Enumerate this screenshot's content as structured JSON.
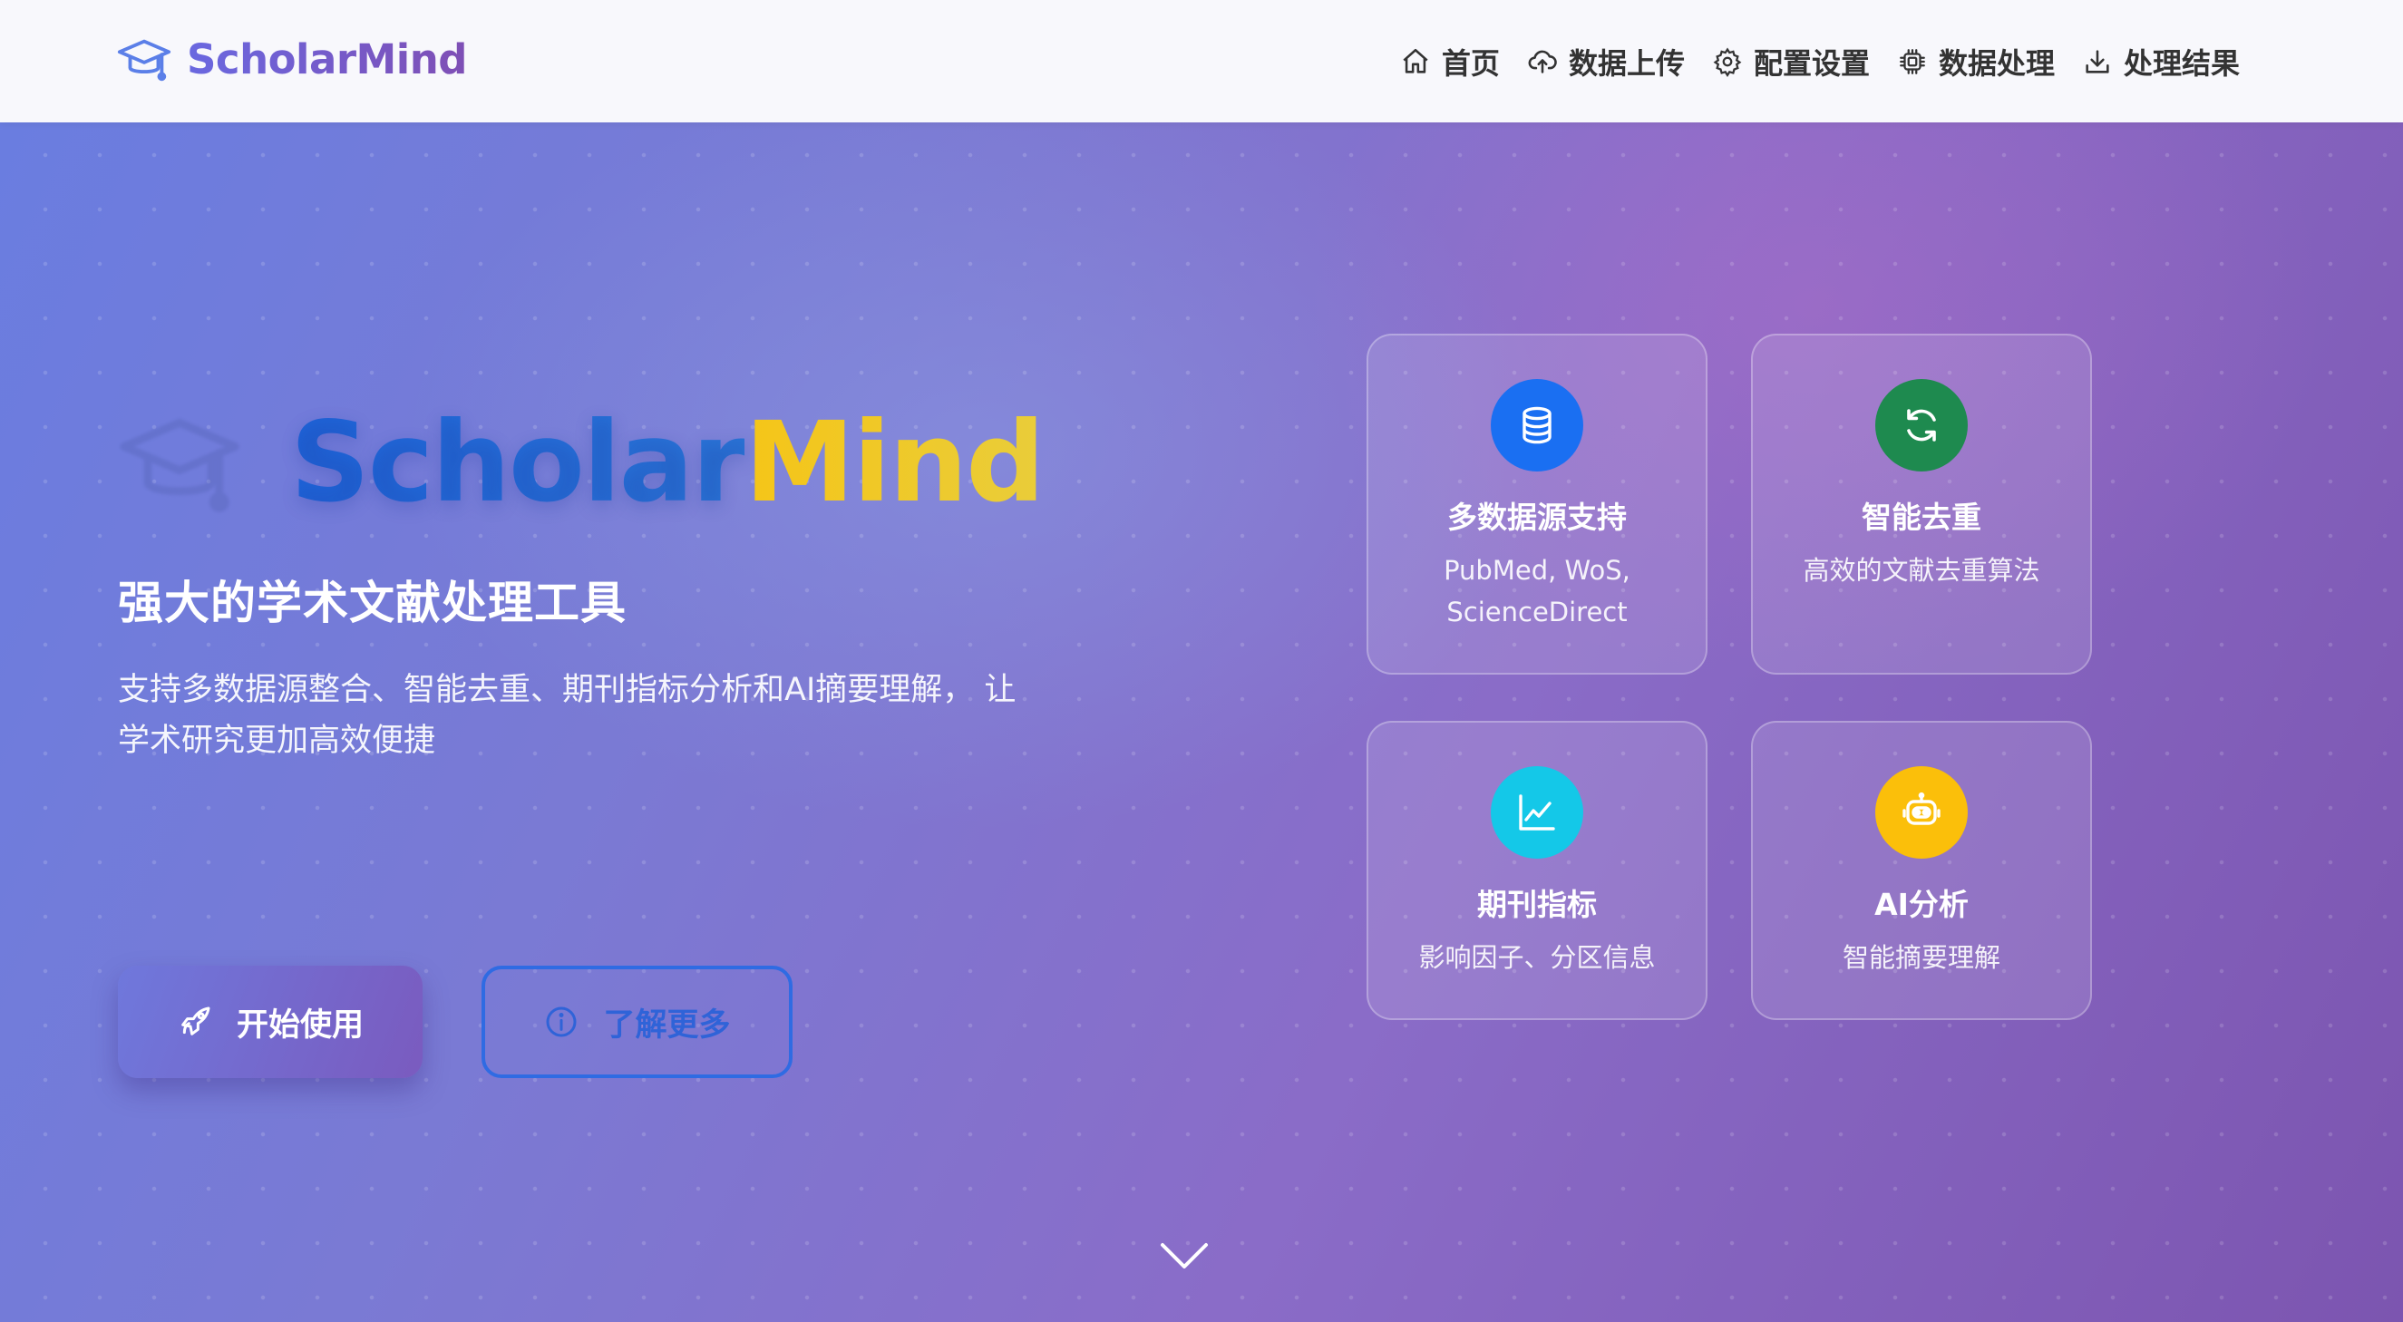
{
  "navbar": {
    "brand": "ScholarMind",
    "items": [
      {
        "label": "首页",
        "icon": "home-icon"
      },
      {
        "label": "数据上传",
        "icon": "cloud-upload-icon"
      },
      {
        "label": "配置设置",
        "icon": "gear-icon"
      },
      {
        "label": "数据处理",
        "icon": "cpu-icon"
      },
      {
        "label": "处理结果",
        "icon": "download-icon"
      }
    ]
  },
  "hero": {
    "title_part1": "Scholar",
    "title_part2": "Mind",
    "subtitle": "强大的学术文献处理工具",
    "description": "支持多数据源整合、智能去重、期刊指标分析和AI摘要理解， 让学术研究更加高效便捷",
    "primary_button": "开始使用",
    "secondary_button": "了解更多"
  },
  "features": [
    {
      "title": "多数据源支持",
      "desc": "PubMed, WoS, ScienceDirect",
      "icon": "database-icon",
      "color": "#1a6ff2"
    },
    {
      "title": "智能去重",
      "desc": "高效的文献去重算法",
      "icon": "refresh-icon",
      "color": "#1e8a4f"
    },
    {
      "title": "期刊指标",
      "desc": "影响因子、分区信息",
      "icon": "chart-line-icon",
      "color": "#14c8e8"
    },
    {
      "title": "AI分析",
      "desc": "智能摘要理解",
      "icon": "robot-icon",
      "color": "#fbbf0a"
    }
  ],
  "colors": {
    "brand_gradient_start": "#6a68e0",
    "brand_gradient_end": "#7f4fb5",
    "title_blue": "#1e63d8",
    "title_yellow": "#f5c518",
    "secondary_button_blue": "#2f6be3"
  }
}
